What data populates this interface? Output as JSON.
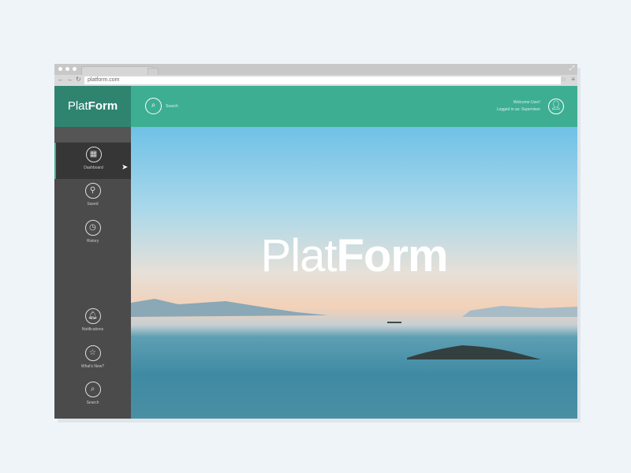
{
  "browser": {
    "url": "platform.com"
  },
  "app": {
    "logo_light": "Plat",
    "logo_bold": "Form",
    "search_label": "Search",
    "welcome": "Welcome User!",
    "logged_in": "Logged in as: Supervisor"
  },
  "sidebar": {
    "items": [
      {
        "label": "Dashboard",
        "icon": "grid-icon",
        "active": true
      },
      {
        "label": "Saved",
        "icon": "pin-icon"
      },
      {
        "label": "History",
        "icon": "clock-icon"
      },
      {
        "label": "Notifications",
        "icon": "bell-icon"
      },
      {
        "label": "What's New?",
        "icon": "star-icon"
      },
      {
        "label": "Search",
        "icon": "search-icon"
      }
    ]
  },
  "hero": {
    "title_light": "Plat",
    "title_bold": "Form"
  },
  "colors": {
    "accent": "#3dae92",
    "logo_bg": "#2f8470",
    "sidebar": "#4b4b4b"
  }
}
